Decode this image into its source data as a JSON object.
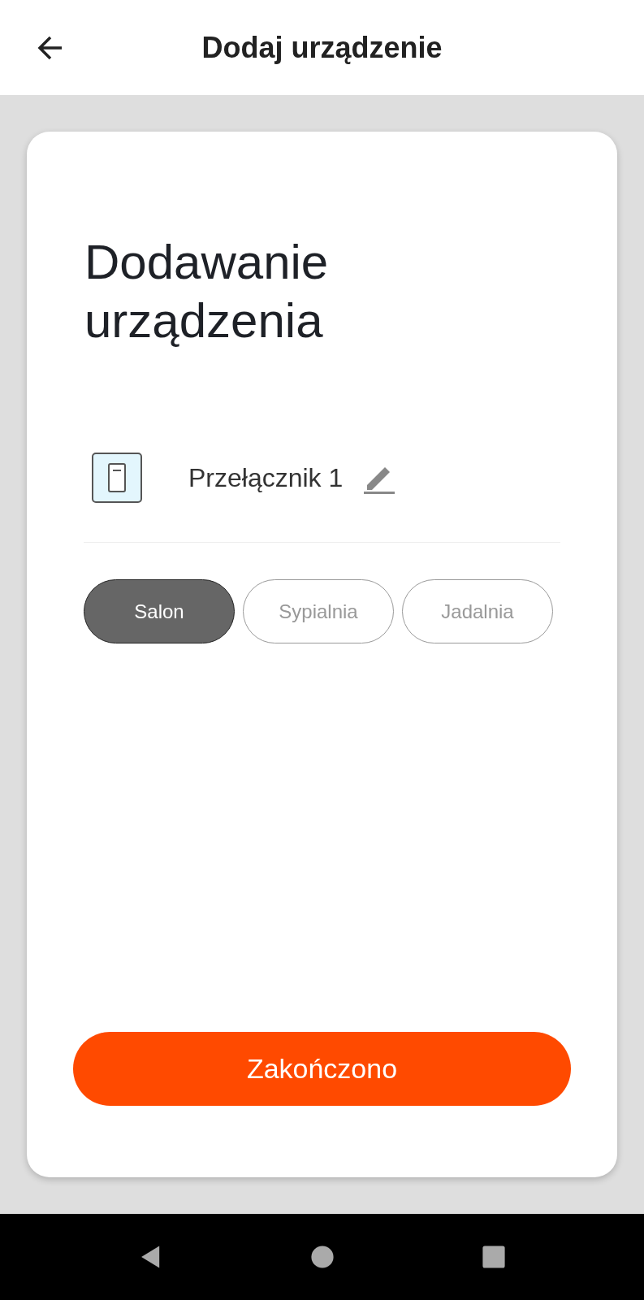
{
  "header": {
    "title": "Dodaj urządzenie"
  },
  "heading": "Dodawanie urządzenia",
  "device": {
    "name": "Przełącznik 1"
  },
  "rooms": [
    {
      "label": "Salon",
      "selected": true
    },
    {
      "label": "Sypialnia",
      "selected": false
    },
    {
      "label": "Jadalnia",
      "selected": false
    }
  ],
  "button": "Zakończono"
}
